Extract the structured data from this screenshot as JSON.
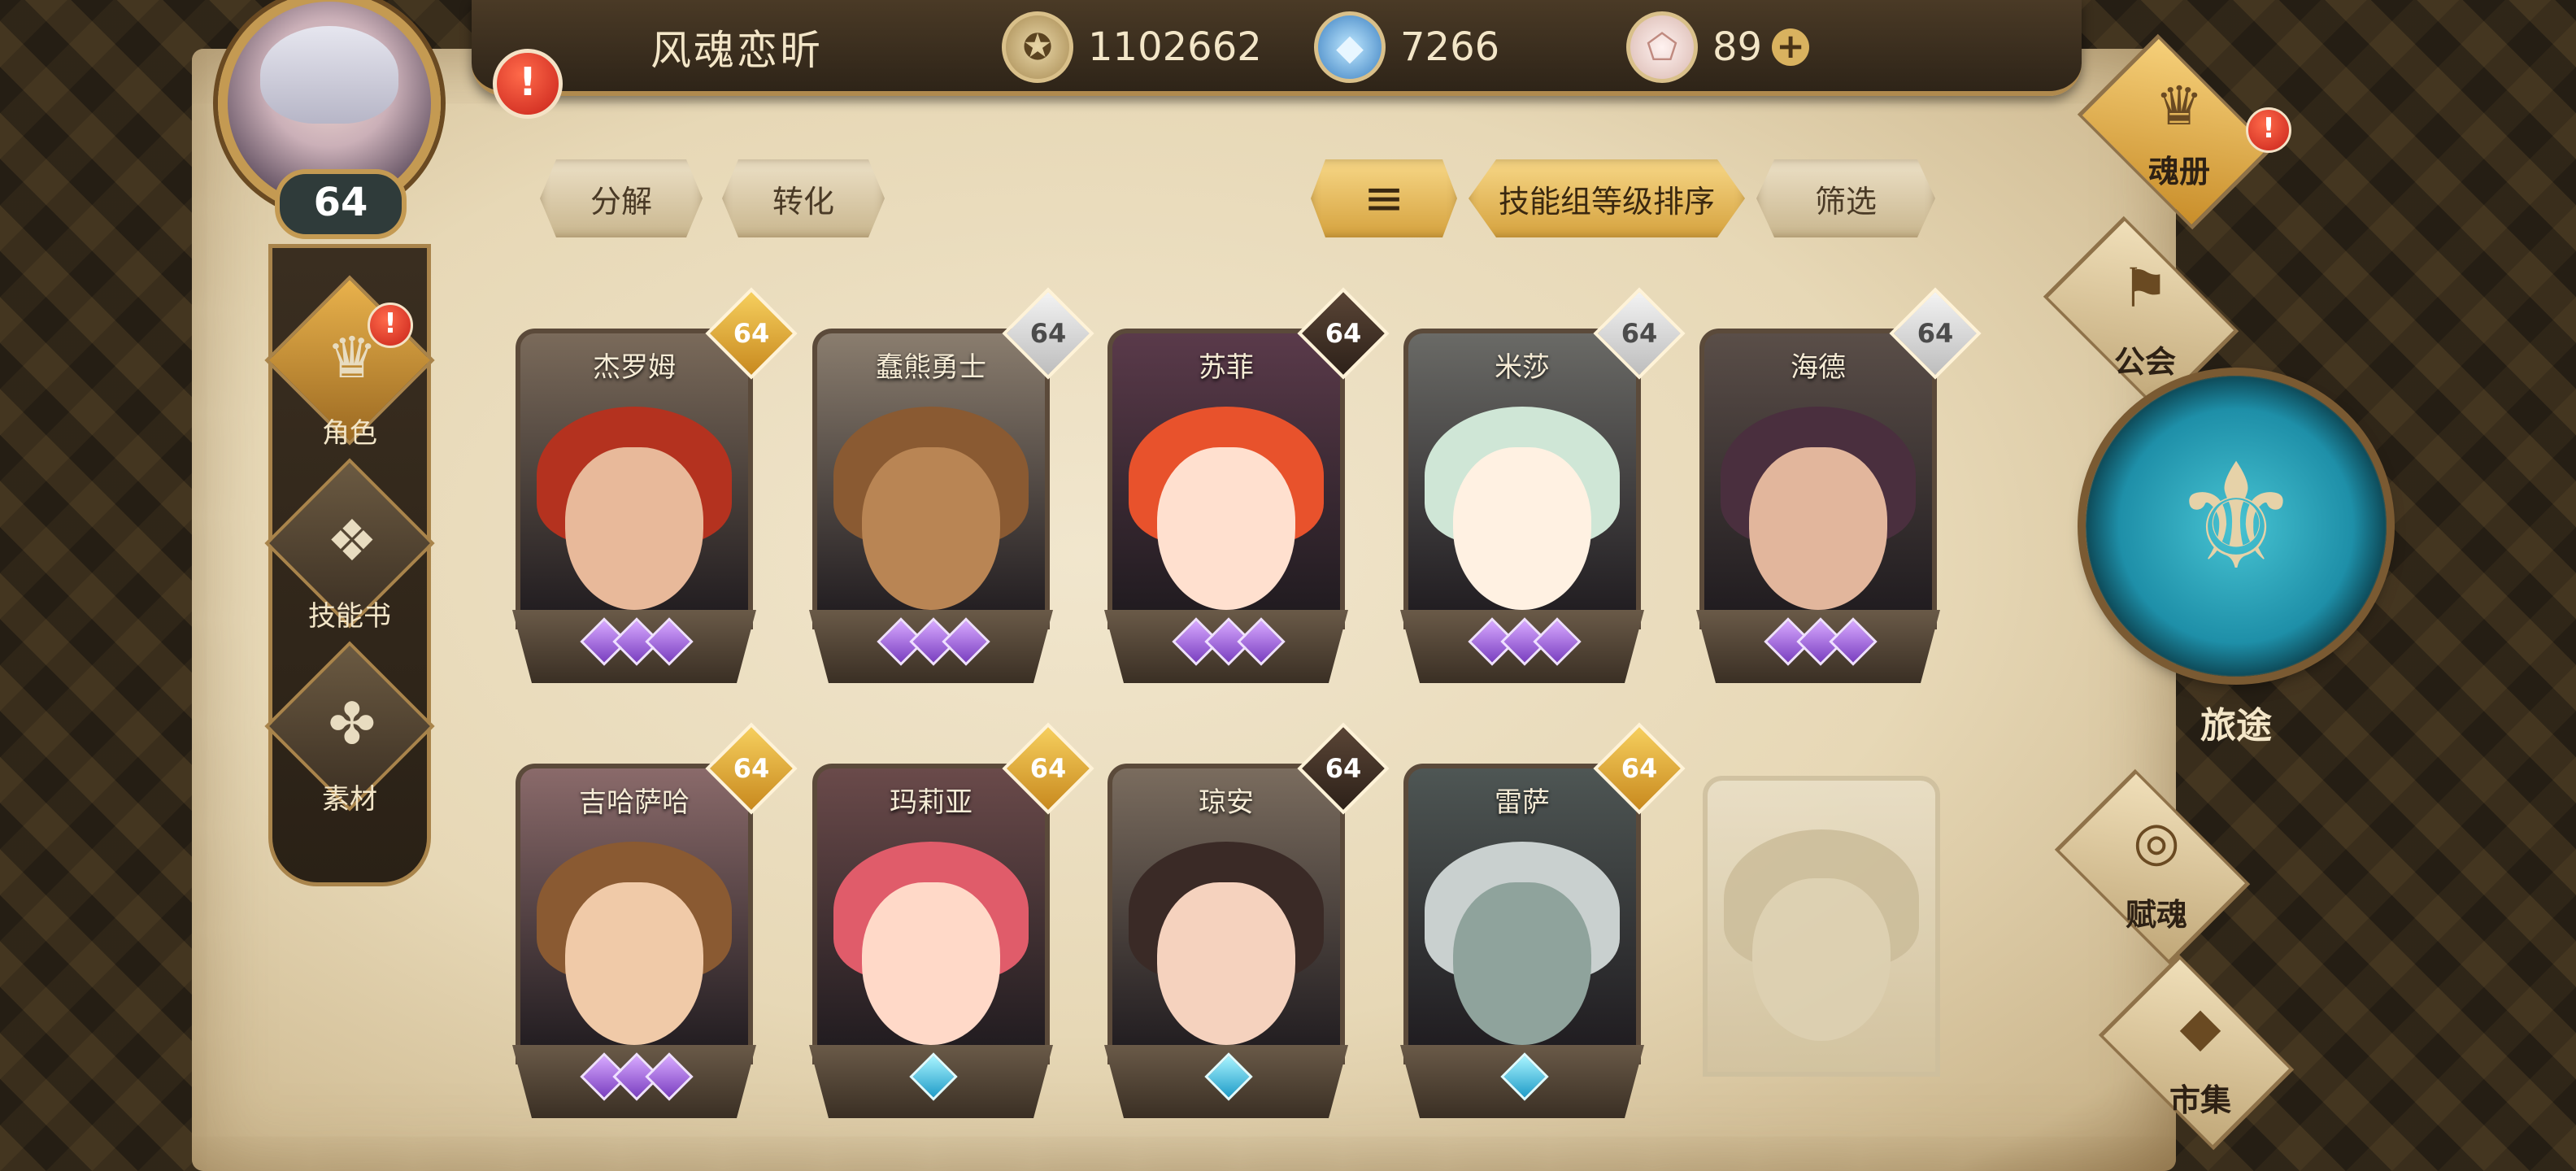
{
  "header": {
    "player_name": "风魂恋昕",
    "player_level": "64",
    "gold": "1102662",
    "crystal": "7266",
    "gem": "89",
    "plus_symbol": "+"
  },
  "alerts": {
    "avatar": "!",
    "role": "!",
    "soul_book": "!"
  },
  "side_nav": {
    "items": [
      {
        "label": "角色",
        "icon": "helmet-icon",
        "glyph": "♛"
      },
      {
        "label": "技能书",
        "icon": "skillbook-icon",
        "glyph": "❖"
      },
      {
        "label": "素材",
        "icon": "material-icon",
        "glyph": "✤"
      }
    ]
  },
  "toolbar": {
    "decompose": "分解",
    "transform": "转化",
    "sort_glyph": "≡",
    "sort_mode": "技能组等级排序",
    "filter": "筛选"
  },
  "cards": [
    {
      "name": "杰罗姆",
      "level": "64",
      "badge": "gold"
    },
    {
      "name": "蠢熊勇士",
      "level": "64",
      "badge": "silver"
    },
    {
      "name": "苏菲",
      "level": "64",
      "badge": "dark"
    },
    {
      "name": "米莎",
      "level": "64",
      "badge": "silver"
    },
    {
      "name": "海德",
      "level": "64",
      "badge": "silver"
    },
    {
      "name": "吉哈萨哈",
      "level": "64",
      "badge": "gold"
    },
    {
      "name": "玛莉亚",
      "level": "64",
      "badge": "gold"
    },
    {
      "name": "琼安",
      "level": "64",
      "badge": "dark"
    },
    {
      "name": "雷萨",
      "level": "64",
      "badge": "gold"
    }
  ],
  "right_nav": {
    "soul_book": {
      "label": "魂册",
      "glyph": "♛"
    },
    "guild": {
      "label": "公会",
      "glyph": "⚑"
    },
    "journey": {
      "label": "旅途",
      "glyph": "⚜"
    },
    "talent": {
      "label": "赋魂",
      "glyph": "◎"
    },
    "market": {
      "label": "市集",
      "glyph": "◆"
    }
  },
  "colors": {
    "accent_gold": "#d5a23e",
    "alert_red": "#c8221a",
    "parchment": "#e7d8b6"
  }
}
